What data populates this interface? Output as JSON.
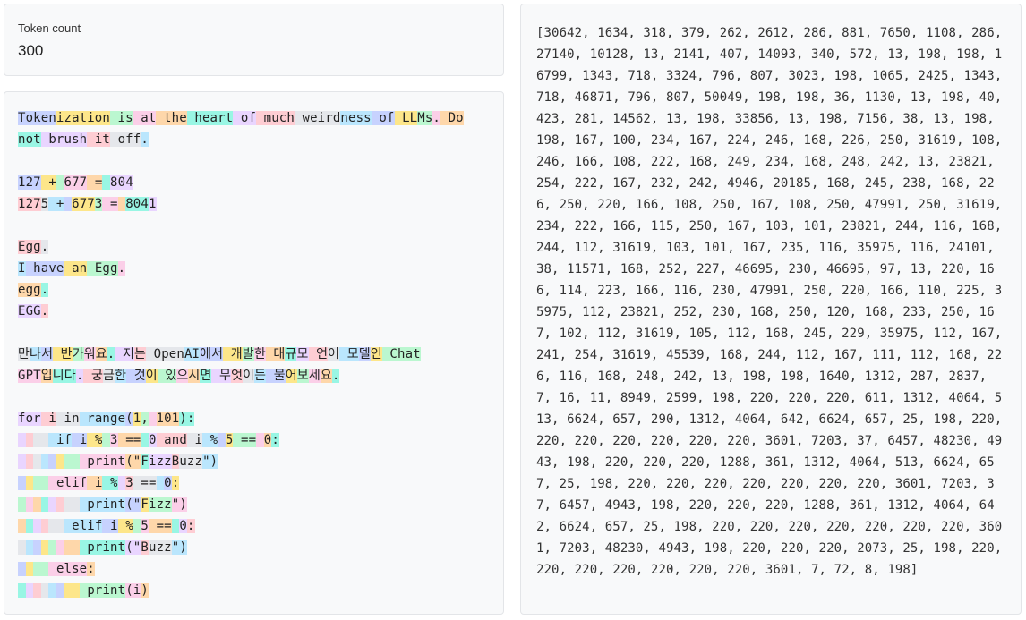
{
  "token_count": {
    "label": "Token count",
    "value": "300"
  },
  "palette": [
    "#c7d2fe",
    "#fde68a",
    "#bbf7d0",
    "#fbcfe8",
    "#fed7aa",
    "#99f6e4",
    "#e9d5ff",
    "#fecdd3",
    "#e5e7eb",
    "#bae6fd"
  ],
  "tokens": [
    "Token",
    "ization",
    " is",
    " at",
    " the",
    " heart",
    " of",
    " much",
    " weird",
    "ness",
    " of",
    " LL",
    "Ms",
    ".",
    " Do",
    "\n",
    "not",
    " brush",
    " it",
    " off",
    ".",
    "\n",
    "\n",
    "127",
    " +",
    " ",
    "677",
    " =",
    " ",
    "804",
    "\n",
    "127",
    "5",
    " +",
    " ",
    "677",
    "3",
    " =",
    " ",
    "804",
    "1",
    "\n",
    "\n",
    "Egg",
    ".",
    "\n",
    "I",
    " have",
    " an",
    " Egg",
    ".",
    "\n",
    "egg",
    ".",
    "\n",
    "EGG",
    ".",
    "\n",
    "\n",
    "만",
    "나",
    "서",
    " 반",
    "가",
    "워",
    "요",
    ".",
    " 저",
    "는",
    " Open",
    "AI",
    "에서",
    " 개",
    "발",
    "한",
    " 대",
    "규",
    "모",
    " 언",
    "어",
    " 모",
    "델",
    "인",
    " Chat",
    "\n",
    "GPT",
    "입",
    "니다",
    ".",
    " 궁",
    "금",
    "한",
    " 것",
    "이",
    " 있",
    "으",
    "시",
    "면",
    " 무",
    "엇",
    "이",
    "든",
    " 물",
    "어",
    "보",
    "세",
    "요",
    ".",
    "\n",
    "\n",
    "for",
    " i",
    " in",
    " range",
    "(",
    "1",
    ",",
    " ",
    "101",
    "):",
    "\n",
    " ",
    " ",
    "  ",
    " if",
    " i",
    " %",
    " ",
    "3",
    " ==",
    " ",
    "0",
    " and",
    " i",
    " %",
    " ",
    "5",
    " ==",
    " ",
    "0",
    ":",
    "\n",
    " ",
    " ",
    " ",
    " ",
    " ",
    " ",
    "  ",
    " print",
    "(\"",
    "F",
    "izz",
    "B",
    "uzz",
    "\")",
    "\n",
    " ",
    " ",
    "  ",
    " elif",
    " i",
    " %",
    " ",
    "3",
    " ==",
    " ",
    "0",
    ":",
    "\n",
    " ",
    " ",
    " ",
    " ",
    " ",
    " ",
    "  ",
    " print",
    "(\"",
    "F",
    "izz",
    "\")",
    "\n",
    " ",
    " ",
    " ",
    " ",
    "  ",
    " elif",
    " i",
    " %",
    " ",
    "5",
    " ==",
    " ",
    "0",
    ":",
    "\n",
    " ",
    " ",
    " ",
    " ",
    " ",
    " ",
    "  ",
    " print",
    "(\"",
    "B",
    "uzz",
    "\")",
    "\n",
    " ",
    " ",
    "  ",
    " else",
    ":",
    "\n",
    " ",
    " ",
    " ",
    " ",
    " ",
    " ",
    "  ",
    " print",
    "(i",
    ")"
  ],
  "token_ids_text": "[30642, 1634, 318, 379, 262, 2612, 286, 881, 7650, 1108, 286, 27140, 10128, 13, 2141, 407, 14093, 340, 572, 13, 198, 198, 16799, 1343, 718, 3324, 796, 807, 3023, 198, 1065, 2425, 1343, 718, 46871, 796, 807, 50049, 198, 198, 36, 1130, 13, 198, 40, 423, 281, 14562, 13, 198, 33856, 13, 198, 7156, 38, 13, 198, 198, 167, 100, 234, 167, 224, 246, 168, 226, 250, 31619, 108, 246, 166, 108, 222, 168, 249, 234, 168, 248, 242, 13, 23821, 254, 222, 167, 232, 242, 4946, 20185, 168, 245, 238, 168, 226, 250, 220, 166, 108, 250, 167, 108, 250, 47991, 250, 31619, 234, 222, 166, 115, 250, 167, 103, 101, 23821, 244, 116, 168, 244, 112, 31619, 103, 101, 167, 235, 116, 35975, 116, 24101, 38, 11571, 168, 252, 227, 46695, 230, 46695, 97, 13, 220, 166, 114, 223, 166, 116, 230, 47991, 250, 220, 166, 110, 225, 35975, 112, 23821, 252, 230, 168, 250, 120, 168, 233, 250, 167, 102, 112, 31619, 105, 112, 168, 245, 229, 35975, 112, 167, 241, 254, 31619, 45539, 168, 244, 112, 167, 111, 112, 168, 226, 116, 168, 248, 242, 13, 198, 198, 1640, 1312, 287, 2837, 7, 16, 11, 8949, 2599, 198, 220, 220, 220, 611, 1312, 4064, 513, 6624, 657, 290, 1312, 4064, 642, 6624, 657, 25, 198, 220, 220, 220, 220, 220, 220, 220, 3601, 7203, 37, 6457, 48230, 4943, 198, 220, 220, 220, 1288, 361, 1312, 4064, 513, 6624, 657, 25, 198, 220, 220, 220, 220, 220, 220, 220, 3601, 7203, 37, 6457, 4943, 198, 220, 220, 220, 1288, 361, 1312, 4064, 642, 6624, 657, 25, 198, 220, 220, 220, 220, 220, 220, 220, 3601, 7203, 48230, 4943, 198, 220, 220, 220, 2073, 25, 198, 220, 220, 220, 220, 220, 220, 220, 3601, 7, 72, 8, 198]"
}
